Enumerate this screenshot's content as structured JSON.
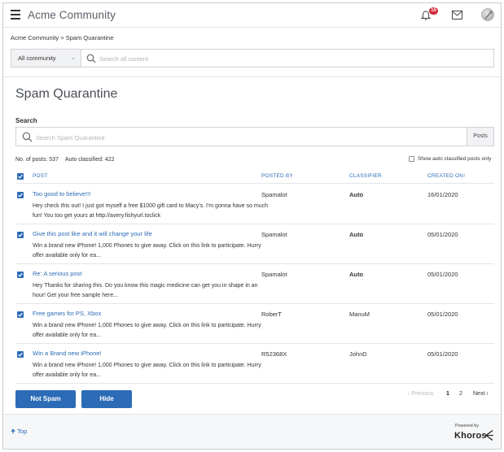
{
  "header": {
    "brand": "Acme Community",
    "notification_count": "15",
    "icons": [
      "menu-icon",
      "bell-icon",
      "mail-icon",
      "avatar"
    ]
  },
  "breadcrumb": "Acme Community > Spam Quarantine",
  "community_search": {
    "scope_selected": "All community",
    "placeholder": "Search all content"
  },
  "page": {
    "title": "Spam Quarantine",
    "search_label": "Search",
    "search_placeholder": "Search Spam Quarantine",
    "search_scope_button": "Posts",
    "stats": {
      "posts": "No. of posts: 537",
      "auto_classified": "Auto classified: 422"
    },
    "show_auto_classified_label": "Show auto classified posts only"
  },
  "table": {
    "columns": {
      "post": "POST",
      "posted_by": "POSTED BY",
      "classifier": "CLASSIFIER",
      "created_on": "CREATED ON"
    },
    "sort_indicator": "↓",
    "rows": [
      {
        "title": "Too good to believe!!!",
        "body": "Hey check this out! I just got myself a free $1000 gift card to Macy's. I'm gonna have so much fun! You too get yours at http://avery.fishyurl.toclick",
        "posted_by": "Spamalot",
        "classifier": "Auto",
        "created_on": "16/01/2020"
      },
      {
        "title": "Give this post like and it will change your life",
        "body": "Win a brand new iPhone! 1,000 Phones to give away. Click on this link to participate. Hurry offer available only for ea...",
        "posted_by": "Spamalot",
        "classifier": "Auto",
        "created_on": "05/01/2020"
      },
      {
        "title": "Re: A serious post",
        "body": "Hey Thanks for sharing this. Do you know this magic medicine can get you in shape in an hour! Get your free sample here...",
        "posted_by": "Spamalot",
        "classifier": "Auto",
        "created_on": "05/01/2020"
      },
      {
        "title": "Free games for PS, Xbox",
        "body": "Win a brand new iPhone! 1,000 Phones to give away. Click on this link to participate. Hurry offer available only for ea...",
        "posted_by": "RoberT",
        "classifier": "ManuM",
        "created_on": "05/01/2020"
      },
      {
        "title": "Win a Brand new iPhone!",
        "body": "Win a brand new iPhone! 1,000 Phones to give away. Click on this link to participate. Hurry offer available only for ea...",
        "posted_by": "R52368X",
        "classifier": "JohnD",
        "created_on": "05/01/2020"
      }
    ]
  },
  "actions": {
    "not_spam": "Not Spam",
    "hide": "Hide"
  },
  "pagination": {
    "previous": "‹ Previous",
    "page1": "1",
    "page2": "2",
    "next": "Next ›"
  },
  "footer": {
    "top_link": "Top",
    "powered_by": "Powered by",
    "vendor": "Khoros"
  },
  "colors": {
    "accent": "#2c6bb6",
    "badge": "#d4293a"
  }
}
